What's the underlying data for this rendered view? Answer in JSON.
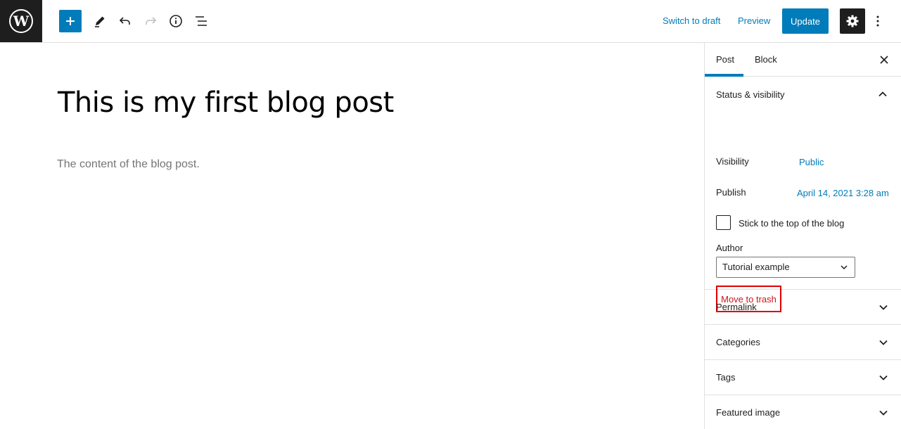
{
  "toolbar": {
    "switch_draft": "Switch to draft",
    "preview": "Preview",
    "update": "Update",
    "icons": [
      "wordpress-logo-icon",
      "plus-icon",
      "pencil-icon",
      "undo-icon",
      "redo-icon",
      "info-icon",
      "list-view-icon",
      "gear-icon",
      "more-vertical-icon"
    ]
  },
  "editor": {
    "title": "This is my first blog post",
    "content": "The content of the blog post."
  },
  "sidebar": {
    "tabs": [
      {
        "label": "Post",
        "active": true
      },
      {
        "label": "Block",
        "active": false
      }
    ],
    "status_visibility": {
      "heading": "Status & visibility",
      "visibility_label": "Visibility",
      "visibility_value": "Public",
      "publish_label": "Publish",
      "publish_value": "April 14, 2021 3:28 am",
      "sticky_label": "Stick to the top of the blog",
      "sticky_checked": false,
      "author_label": "Author",
      "author_value": "Tutorial example",
      "trash_label": "Move to trash"
    },
    "panels": [
      {
        "label": "Permalink"
      },
      {
        "label": "Categories"
      },
      {
        "label": "Tags"
      },
      {
        "label": "Featured image"
      }
    ]
  },
  "colors": {
    "accent": "#007cba",
    "dark": "#1e1e1e",
    "trash_red": "#cc1818",
    "highlight_border": "#e00000"
  }
}
